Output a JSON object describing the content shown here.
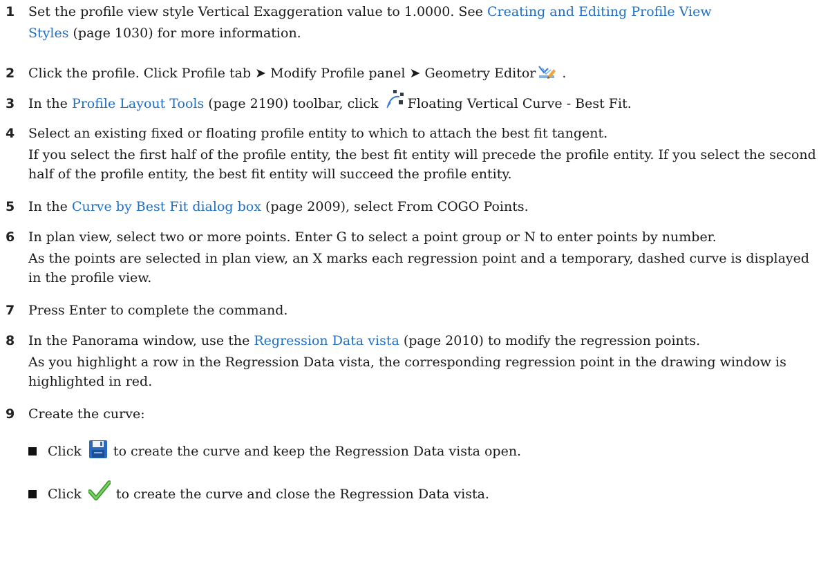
{
  "steps": [
    {
      "number": "1",
      "line1_before": "Set the profile view style Vertical Exaggeration value to 1.0000. See ",
      "line1_link": "Creating and Editing Profile View",
      "line2_link": "Styles",
      "line2_after": " (page 1030) for more information."
    },
    {
      "number": "2",
      "text": "Click the profile. Click Profile tab ➤ Modify Profile panel ➤ Geometry Editor",
      "after_icon": " .",
      "icon": "geometry-editor-icon"
    },
    {
      "number": "3",
      "before_link": "In the ",
      "link": "Profile Layout Tools",
      "after_link": " (page 2190) toolbar, click ",
      "icon": "floating-vertical-curve-best-fit-icon",
      "after_icon": "Floating Vertical Curve - Best Fit."
    },
    {
      "number": "4",
      "line1": "Select an existing fixed or floating profile entity to which to attach the best fit tangent.",
      "para": "If you select the first half of the profile entity, the best fit entity will precede the profile entity. If you select the second half of the profile entity, the best fit entity will succeed the profile entity."
    },
    {
      "number": "5",
      "before_link": "In the ",
      "link": "Curve by Best Fit dialog box",
      "after_link": " (page 2009), select From COGO Points."
    },
    {
      "number": "6",
      "line1": "In plan view, select two or more points. Enter G to select a point group or N to enter points by number.",
      "para": "As the points are selected in plan view, an X marks each regression point and a temporary, dashed curve is displayed in the profile view."
    },
    {
      "number": "7",
      "line1": "Press Enter to complete the command."
    },
    {
      "number": "8",
      "before_link": "In the Panorama window, use the ",
      "link": "Regression Data vista",
      "after_link": " (page 2010) to modify the regression points.",
      "para": "As you highlight a row in the Regression Data vista, the corresponding regression point in the drawing window is highlighted in red."
    },
    {
      "number": "9",
      "line1": "Create the curve:",
      "bullets": [
        {
          "before_icon": "Click ",
          "icon": "save-icon",
          "after_icon": " to create the curve and keep the Regression Data vista open."
        },
        {
          "before_icon": "Click ",
          "icon": "checkmark-icon",
          "after_icon": " to create the curve and close the Regression Data vista."
        }
      ]
    }
  ]
}
